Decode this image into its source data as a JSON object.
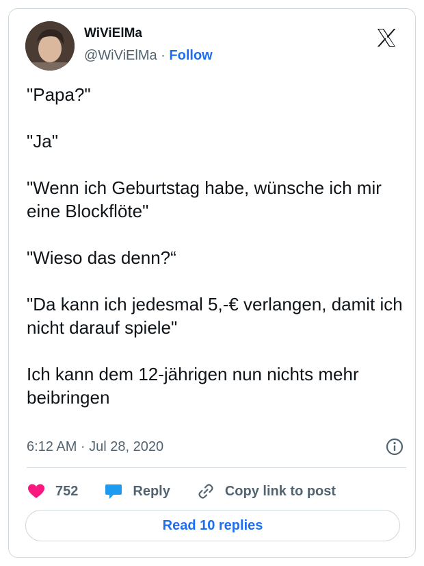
{
  "author": {
    "display_name": "WiViElMa",
    "handle": "@WiViElMa",
    "separator": " · ",
    "follow_label": "Follow"
  },
  "tweet": {
    "paragraphs": [
      "\"Papa?\"",
      "\"Ja\"",
      "\"Wenn ich Geburtstag habe, wünsche ich mir eine Blockflöte\"",
      "\"Wieso das denn?“",
      "\"Da kann ich jedesmal 5,-€ verlangen, damit ich nicht darauf spiele\"",
      "Ich kann dem 12-jährigen nun nichts mehr beibringen"
    ],
    "timestamp": "6:12 AM · Jul 28, 2020"
  },
  "actions": {
    "like_count": "752",
    "reply_label": "Reply",
    "copy_label": "Copy link to post"
  },
  "footer": {
    "read_replies_label": "Read 10 replies"
  },
  "icons": {
    "logo": "x-logo-icon",
    "info": "info-icon",
    "like": "heart-icon",
    "reply": "speech-bubble-icon",
    "copy": "link-icon"
  },
  "colors": {
    "link": "#1d6ff2",
    "heart": "#f91880",
    "reply_bubble": "#1d9bf0",
    "muted_text": "#536471",
    "border": "#cfd9de"
  }
}
